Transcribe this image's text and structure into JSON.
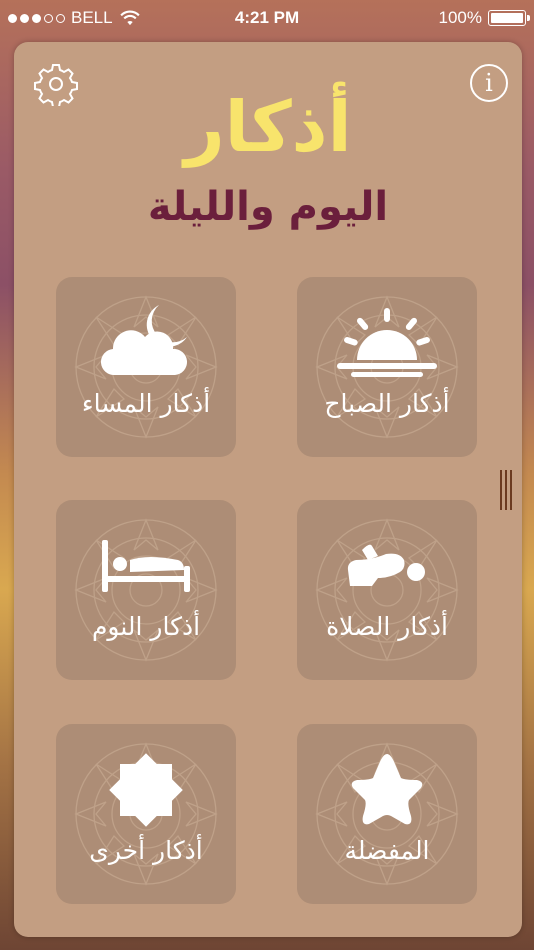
{
  "status_bar": {
    "carrier": "BELL",
    "time": "4:21 PM",
    "battery": "100%"
  },
  "header": {
    "title": "أذكار",
    "subtitle": "اليوم والليلة",
    "info_label": "i"
  },
  "tiles": [
    {
      "label": "أذكار الصباح",
      "icon": "sunrise-icon"
    },
    {
      "label": "أذكار المساء",
      "icon": "moon-cloud-icon"
    },
    {
      "label": "أذكار الصلاة",
      "icon": "prostrating-person-icon"
    },
    {
      "label": "أذكار النوم",
      "icon": "bed-icon"
    },
    {
      "label": "المفضلة",
      "icon": "star-icon"
    },
    {
      "label": "أذكار أخرى",
      "icon": "octagram-icon"
    }
  ],
  "colors": {
    "card": "#c39e82",
    "tile": "#ad8d76",
    "title": "#f8e46c",
    "subtitle": "#6b1f3c"
  }
}
